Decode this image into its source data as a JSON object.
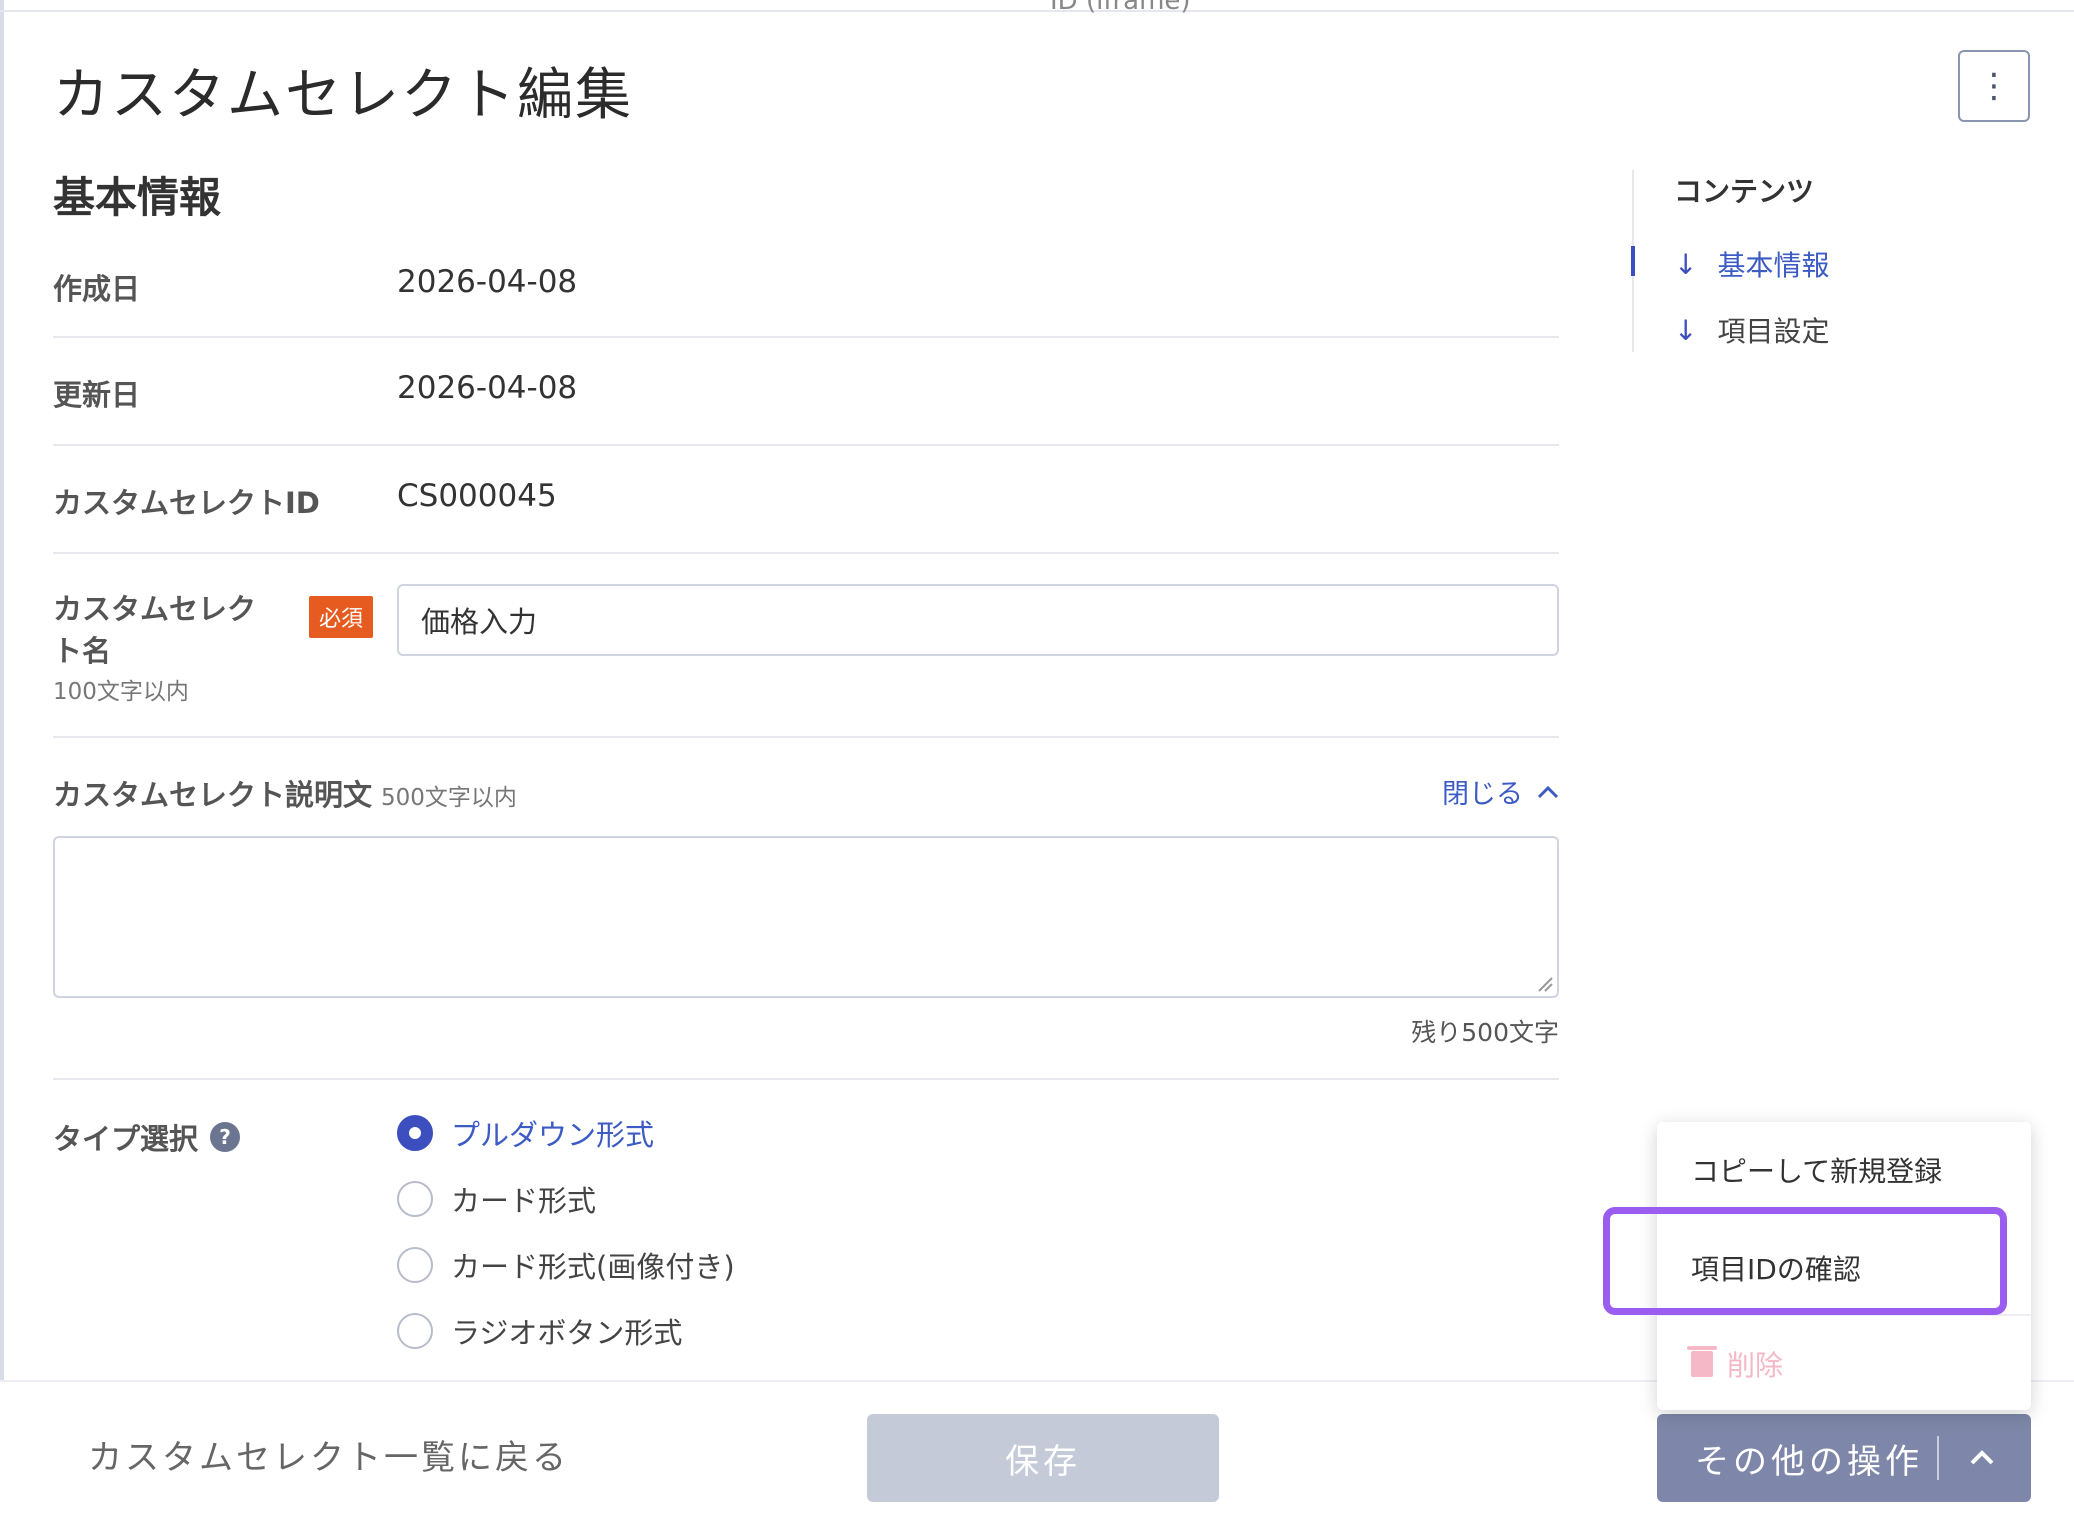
{
  "frame": {
    "top_clip_text": "ID (iframe)"
  },
  "header": {
    "title": "カスタムセレクト編集",
    "menu_icon": "kebab-icon"
  },
  "basic_info": {
    "section_title": "基本情報",
    "created_label": "作成日",
    "created_value": "2026-04-08",
    "updated_label": "更新日",
    "updated_value": "2026-04-08",
    "id_label": "カスタムセレクトID",
    "id_value": "CS000045",
    "name_label": "カスタムセレクト名",
    "name_required": "必須",
    "name_limit": "100文字以内",
    "name_value": "価格入力",
    "desc_label": "カスタムセレクト説明文",
    "desc_limit": "500文字以内",
    "desc_toggle": "閉じる",
    "desc_value": "",
    "desc_remaining": "残り500文字"
  },
  "type_select": {
    "label": "タイプ選択",
    "help_icon": "question-icon",
    "options": [
      {
        "label": "プルダウン形式",
        "checked": true
      },
      {
        "label": "カード形式",
        "checked": false
      },
      {
        "label": "カード形式(画像付き)",
        "checked": false
      },
      {
        "label": "ラジオボタン形式",
        "checked": false
      }
    ]
  },
  "toc": {
    "title": "コンテンツ",
    "items": [
      {
        "label": "基本情報",
        "active": true
      },
      {
        "label": "項目設定",
        "active": false
      }
    ]
  },
  "footer": {
    "back_label": "カスタムセレクト一覧に戻る",
    "save_label": "保存",
    "more_label": "その他の操作"
  },
  "more_menu": {
    "items": [
      {
        "label": "コピーして新規登録",
        "disabled": false
      },
      {
        "label": "項目IDの確認",
        "disabled": false,
        "highlighted": true
      },
      {
        "label": "削除",
        "disabled": true,
        "icon": "trash-icon"
      }
    ]
  },
  "colors": {
    "accent": "#3d4fbf",
    "link": "#3d5bc4",
    "required_badge": "#e65b1f",
    "highlight": "#9b5cf0",
    "disabled_danger": "#f4b8c6"
  }
}
